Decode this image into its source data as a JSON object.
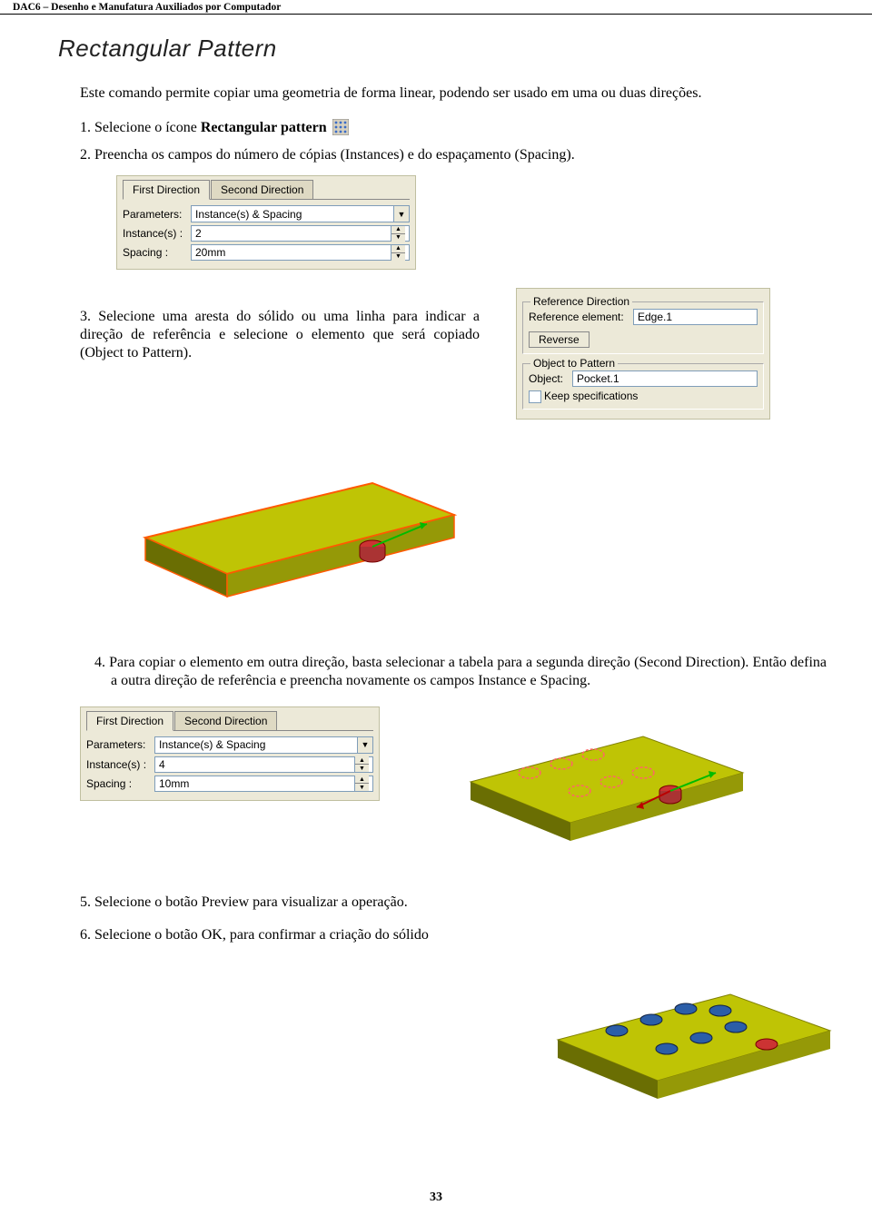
{
  "header": "DAC6 – Desenho e Manufatura Auxiliados por Computador",
  "title": "Rectangular Pattern",
  "intro": "Este comando permite copiar uma geometria de forma linear, podendo ser usado em uma ou duas direções.",
  "step1_prefix": "1.  Selecione o ícone ",
  "step1_bold": "Rectangular pattern",
  "step2": "2.  Preencha os campos do número de cópias  (Instances) e do espaçamento (Spacing).",
  "dialog1": {
    "tab1": "First Direction",
    "tab2": "Second Direction",
    "param_lbl": "Parameters:",
    "param_val": "Instance(s) & Spacing",
    "instance_lbl": "Instance(s) :",
    "instance_val": "2",
    "spacing_lbl": "Spacing :",
    "spacing_val": "20mm"
  },
  "step3": "3.    Selecione uma aresta do sólido ou uma linha para indicar a direção de referência e selecione o elemento que será copiado (Object to Pattern).",
  "dialog_ref": {
    "ref_legend": "Reference Direction",
    "ref_lbl": "Reference element:",
    "ref_val": "Edge.1",
    "reverse": "Reverse",
    "obj_legend": "Object to Pattern",
    "obj_lbl": "Object:",
    "obj_val": "Pocket.1",
    "keep": "Keep specifications"
  },
  "step4": "4. Para copiar o elemento em outra direção, basta selecionar a tabela para a segunda direção (Second Direction). Então defina a outra direção de referência e preencha novamente os campos Instance e Spacing.",
  "dialog2": {
    "tab1": "First Direction",
    "tab2": "Second Direction",
    "param_lbl": "Parameters:",
    "param_val": "Instance(s) & Spacing",
    "instance_lbl": "Instance(s) :",
    "instance_val": "4",
    "spacing_lbl": "Spacing :",
    "spacing_val": "10mm"
  },
  "step5": "5.  Selecione o botão Preview para visualizar a operação.",
  "step6": "6. Selecione o botão OK, para confirmar a criação do sólido",
  "page_number": "33"
}
